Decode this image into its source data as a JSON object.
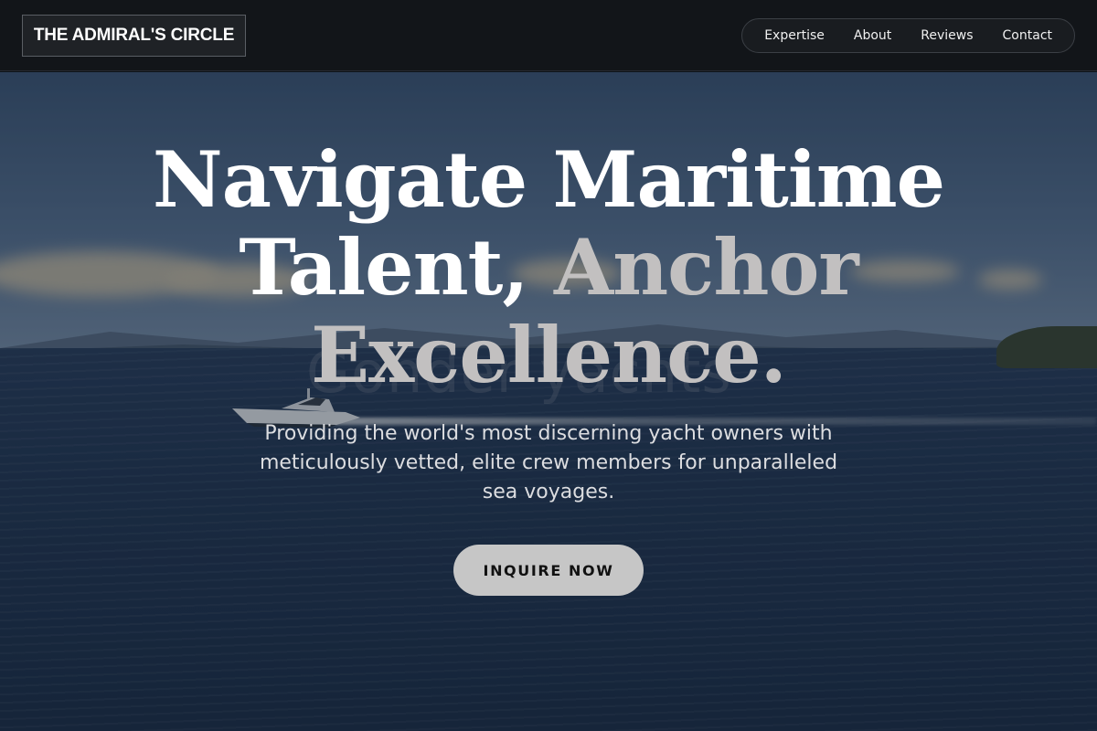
{
  "brand": {
    "name": "THE ADMIRAL'S CIRCLE"
  },
  "nav": {
    "items": [
      {
        "label": "Expertise"
      },
      {
        "label": "About"
      },
      {
        "label": "Reviews"
      },
      {
        "label": "Contact"
      }
    ]
  },
  "hero": {
    "title_line1": "Navigate Maritime",
    "title_line2_main": "Talent, ",
    "title_line2_accent": "Anchor",
    "title_line3_accent": "Excellence.",
    "subtitle": "Providing the world's most discerning yacht owners with meticulously vetted, elite crew members for unparalleled sea voyages.",
    "cta_label": "INQUIRE NOW",
    "background_watermark": "Gonder yachts"
  },
  "colors": {
    "header_bg": "#121519",
    "accent_text": "#c2c0c0",
    "cta_bg": "#c6c6c6",
    "cta_text": "#111111"
  }
}
